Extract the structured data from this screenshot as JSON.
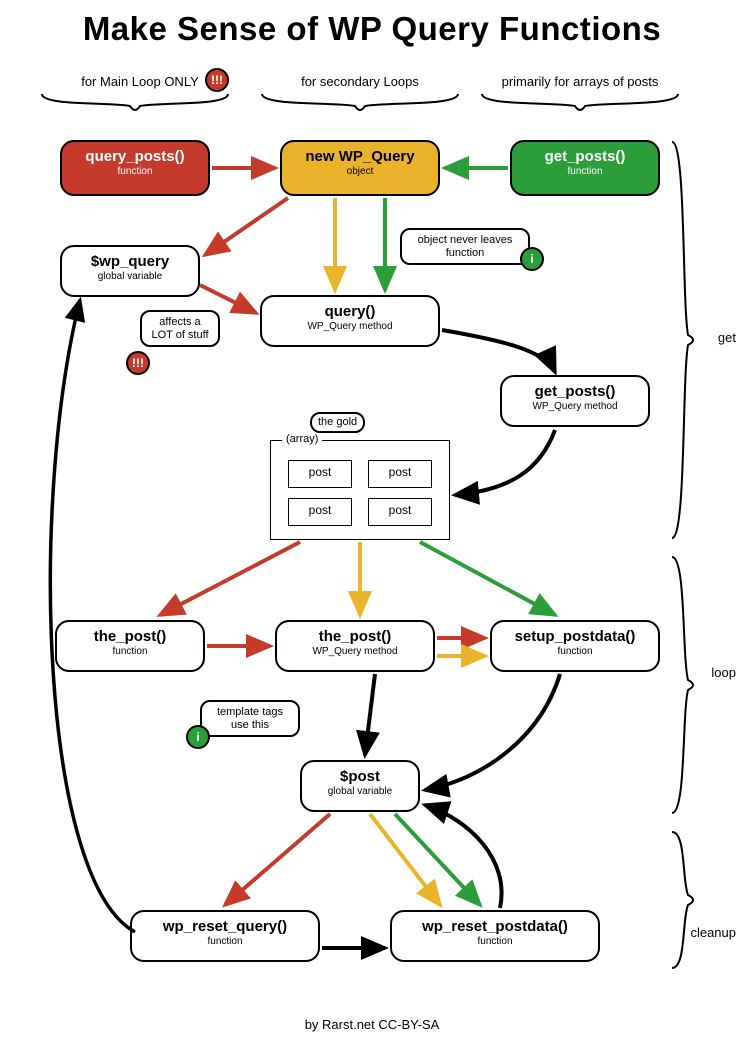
{
  "title": "Make Sense of WP Query Functions",
  "columns": {
    "main": "for Main Loop ONLY",
    "secondary": "for secondary Loops",
    "arrays": "primarily for arrays of posts"
  },
  "badges": {
    "warn": "!!!",
    "info": "i"
  },
  "boxes": {
    "query_posts": {
      "name": "query_posts()",
      "sub": "function"
    },
    "new_wp_query": {
      "name": "new WP_Query",
      "sub": "object"
    },
    "get_posts_fn": {
      "name": "get_posts()",
      "sub": "function"
    },
    "wp_query_glob": {
      "name": "$wp_query",
      "sub": "global variable"
    },
    "query_method": {
      "name": "query()",
      "sub": "WP_Query method"
    },
    "get_posts_meth": {
      "name": "get_posts()",
      "sub": "WP_Query method"
    },
    "the_post_fn": {
      "name": "the_post()",
      "sub": "function"
    },
    "the_post_meth": {
      "name": "the_post()",
      "sub": "WP_Query method"
    },
    "setup_postdata": {
      "name": "setup_postdata()",
      "sub": "function"
    },
    "post_glob": {
      "name": "$post",
      "sub": "global variable"
    },
    "wp_reset_query": {
      "name": "wp_reset_query()",
      "sub": "function"
    },
    "wp_reset_postdata": {
      "name": "wp_reset_postdata()",
      "sub": "function"
    }
  },
  "notes": {
    "object_never": "object never leaves function",
    "affects": "affects a LOT of stuff",
    "the_gold": "the gold",
    "template_tags": "template tags use this"
  },
  "array_box": {
    "label": "(array)",
    "cells": [
      "post",
      "post",
      "post",
      "post"
    ]
  },
  "sections": {
    "get": "get",
    "loop": "loop",
    "cleanup": "cleanup"
  },
  "footer": "by Rarst.net CC-BY-SA",
  "colors": {
    "red": "#c63a2c",
    "yellow": "#e9b42c",
    "green": "#2c9e39",
    "black": "#000"
  }
}
